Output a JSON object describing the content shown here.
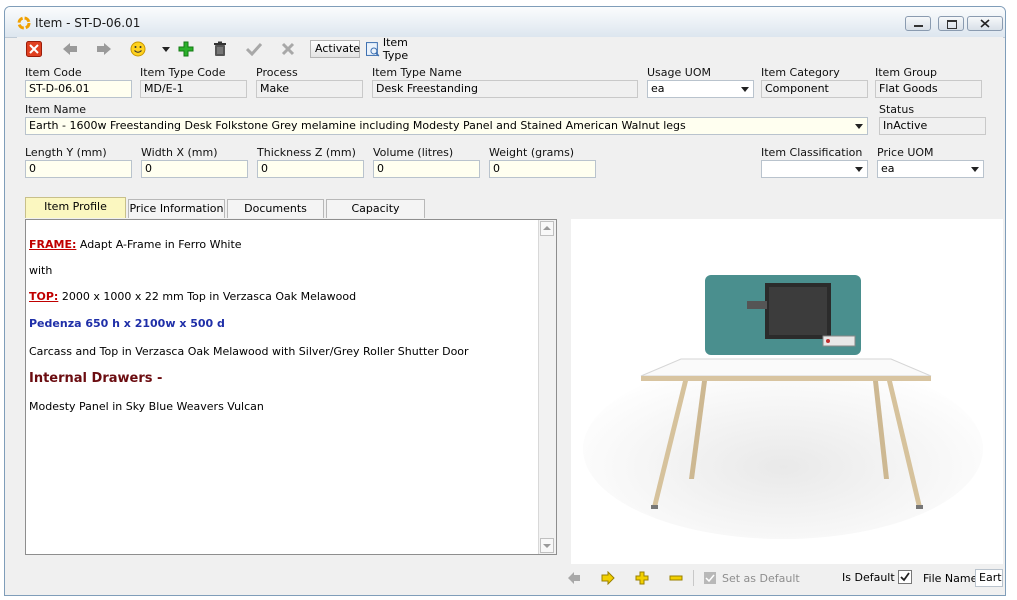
{
  "window": {
    "title": "Item - ST-D-06.01"
  },
  "toolbar": {
    "activate_label": "Activate",
    "item_type_label": "Item Type"
  },
  "fields": {
    "item_code": {
      "label": "Item Code",
      "value": "ST-D-06.01"
    },
    "item_type_code": {
      "label": "Item Type Code",
      "value": "MD/E-1"
    },
    "process": {
      "label": "Process",
      "value": "Make"
    },
    "item_type_name": {
      "label": "Item Type Name",
      "value": "Desk Freestanding"
    },
    "usage_uom": {
      "label": "Usage UOM",
      "value": "ea"
    },
    "item_category": {
      "label": "Item Category",
      "value": "Component"
    },
    "item_group": {
      "label": "Item Group",
      "value": "Flat Goods"
    },
    "item_name": {
      "label": "Item Name",
      "value": "Earth - 1600w Freestanding Desk Folkstone Grey melamine including Modesty Panel and Stained American Walnut legs"
    },
    "status": {
      "label": "Status",
      "value": "InActive"
    },
    "length": {
      "label": "Length Y (mm)",
      "value": "0"
    },
    "width": {
      "label": "Width X (mm)",
      "value": "0"
    },
    "thickness": {
      "label": "Thickness Z (mm)",
      "value": "0"
    },
    "volume": {
      "label": "Volume (litres)",
      "value": "0"
    },
    "weight": {
      "label": "Weight (grams)",
      "value": "0"
    },
    "item_classification": {
      "label": "Item Classification",
      "value": ""
    },
    "price_uom": {
      "label": "Price UOM",
      "value": "ea"
    }
  },
  "tabs": [
    {
      "label": "Item Profile",
      "active": true
    },
    {
      "label": "Price Information",
      "active": false
    },
    {
      "label": "Documents",
      "active": false
    },
    {
      "label": "Capacity Planning",
      "active": false
    }
  ],
  "profile": {
    "frame_label": "FRAME:",
    "frame_text": " Adapt A-Frame in Ferro White",
    "with_text": "with",
    "top_label": "TOP:",
    "top_text": " 2000 x 1000 x 22 mm Top in Verzasca Oak Melawood",
    "pedenza_text": "Pedenza 650 h x 2100w x 500 d",
    "carcass_text": "Carcass and Top in Verzasca Oak Melawood with Silver/Grey Roller Shutter Door",
    "drawers_text": "Internal Drawers -",
    "modesty_text": "Modesty Panel in Sky Blue Weavers Vulcan"
  },
  "image_bar": {
    "set_default_label": "Set as Default",
    "is_default_label": "Is Default",
    "is_default_checked": true,
    "file_name_label": "File Name",
    "file_name_value": "Earth"
  },
  "colors": {
    "accent_yellow": "#fbf7c0",
    "field_bg": "#fffff0",
    "red_label": "#c00000",
    "blue_label": "#1f2fa8",
    "maroon_label": "#6b0c10",
    "panel_teal": "#4a8f8e"
  }
}
